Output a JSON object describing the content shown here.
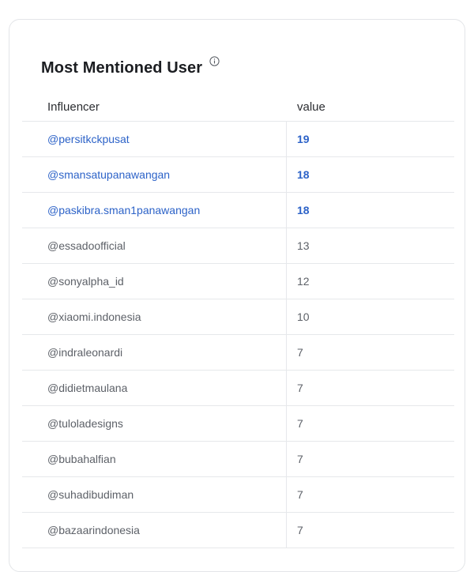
{
  "widget": {
    "title": "Most Mentioned User",
    "info_icon": "info-circle-icon"
  },
  "table": {
    "columns": [
      "Influencer",
      "value"
    ],
    "rows": [
      {
        "user": "@persitkckpusat",
        "value": "19",
        "highlight": true
      },
      {
        "user": "@smansatupanawangan",
        "value": "18",
        "highlight": true
      },
      {
        "user": "@paskibra.sman1panawangan",
        "value": "18",
        "highlight": true
      },
      {
        "user": "@essadoofficial",
        "value": "13",
        "highlight": false
      },
      {
        "user": "@sonyalpha_id",
        "value": "12",
        "highlight": false
      },
      {
        "user": "@xiaomi.indonesia",
        "value": "10",
        "highlight": false
      },
      {
        "user": "@indraleonardi",
        "value": "7",
        "highlight": false
      },
      {
        "user": "@didietmaulana",
        "value": "7",
        "highlight": false
      },
      {
        "user": "@tuloladesigns",
        "value": "7",
        "highlight": false
      },
      {
        "user": "@bubahalfian",
        "value": "7",
        "highlight": false
      },
      {
        "user": "@suhadibudiman",
        "value": "7",
        "highlight": false
      },
      {
        "user": "@bazaarindonesia",
        "value": "7",
        "highlight": false
      }
    ]
  },
  "colors": {
    "link": "#2d63c8",
    "text": "#5d6168",
    "border": "#e6e8eb"
  }
}
